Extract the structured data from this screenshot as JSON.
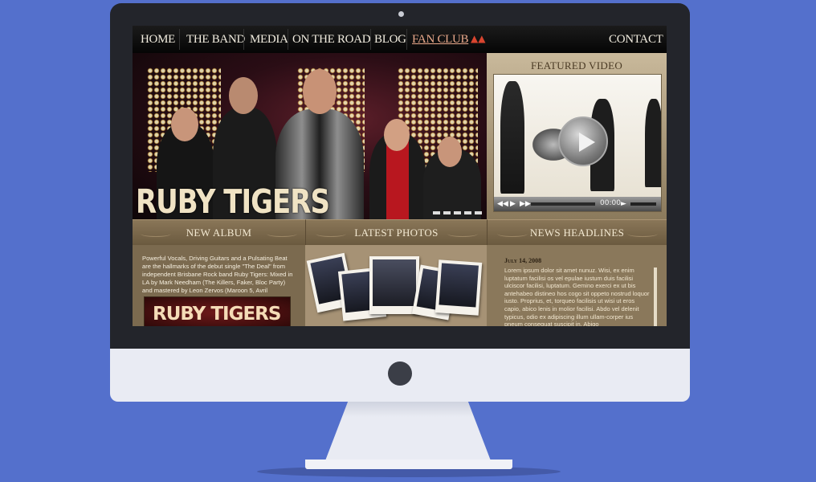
{
  "nav": {
    "items": [
      "HOME",
      "THE BAND",
      "MEDIA",
      "ON THE ROAD",
      "BLOG",
      "FAN CLUB"
    ],
    "contact": "CONTACT"
  },
  "hero": {
    "band_name": "RUBY TIGERS"
  },
  "featured": {
    "title": "FEATURED VIDEO",
    "time": "00:00"
  },
  "sections": {
    "album_title": "NEW ALBUM",
    "photos_title": "LATEST PHOTOS",
    "news_title": "NEWS HEADLINES"
  },
  "album": {
    "text": "Powerful Vocals, Driving Guitars and a Pulsating Beat are the hallmarks of the debut single \"The Deal\" from independent Brisbane Rock band Ruby Tigers: Mixed in LA by Mark Needham (The Killers, Faker, Bloc Party) and mastered by Leon Zervos (Maroon 5, Avril",
    "cover_title": "RUBY TIGERS"
  },
  "news": {
    "date": "July 14, 2008",
    "text": "Lorem ipsum dolor sit amet nunuz. Wisi, ex enim luptatum facilisi os vel epulae iustum duis facilisi ulciscor facilisi, luptatum. Gemino exerci ex ut bis antehabeo distineo hos cogo sit oppeto nostrud loquor iusto. Proprius, et, torqueo facilisis ut wisi ut eros capio, abico lenis in molior facilisi. Abdo vel delenit typicus, odio ex adipiscing illum ullam-corper ius pneum consequat suscipit in. Abigo"
  },
  "colors": {
    "background": "#5470cc",
    "bezel": "#23252b",
    "panel": "#8a7658"
  }
}
